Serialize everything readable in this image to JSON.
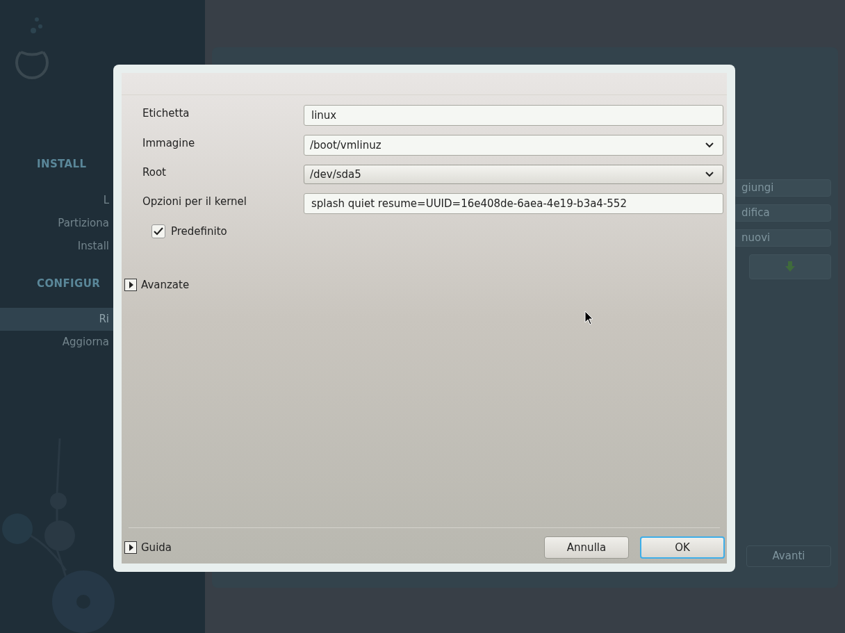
{
  "background": {
    "sidebar": {
      "sections": [
        {
          "heading": "INSTALL",
          "items": [
            {
              "label": "L",
              "selected": false
            },
            {
              "label": "Partiziona",
              "selected": false
            },
            {
              "label": "Install",
              "selected": false
            }
          ]
        },
        {
          "heading": "CONFIGUR",
          "items": [
            {
              "label": "Ri",
              "selected": true
            },
            {
              "label": "Aggiorna",
              "selected": false
            }
          ]
        }
      ]
    },
    "side_buttons": [
      "giungi",
      "difica",
      "nuovi"
    ],
    "next_button": "Avanti"
  },
  "dialog": {
    "fields": [
      {
        "label": "Etichetta",
        "kind": "text",
        "value": "linux"
      },
      {
        "label": "Immagine",
        "kind": "combo",
        "value": "/boot/vmlinuz"
      },
      {
        "label": "Root",
        "kind": "dropdown",
        "value": "/dev/sda5"
      },
      {
        "label": "Opzioni per il kernel",
        "kind": "text",
        "value": "splash quiet resume=UUID=16e408de-6aea-4e19-b3a4-552"
      }
    ],
    "default_checkbox": {
      "label": "Predefinito",
      "checked": true
    },
    "advanced": {
      "label": "Avanzate",
      "expanded": false
    },
    "help": {
      "label": "Guida",
      "expanded": false
    },
    "buttons": [
      {
        "label": "Annulla",
        "focused": false
      },
      {
        "label": "OK",
        "focused": true
      }
    ]
  }
}
